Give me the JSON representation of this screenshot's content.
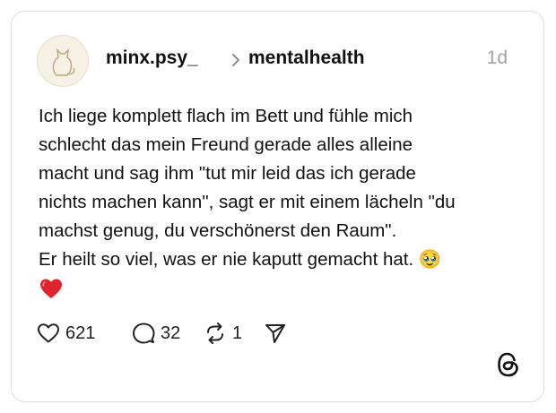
{
  "post": {
    "author": "minx.psy_",
    "community": "mentalhealth",
    "time": "1d",
    "text": "Ich liege komplett flach im Bett und fühle mich\nschlecht das mein Freund gerade alles alleine\nmacht und sag ihm \"tut mir leid das ich gerade\nnichts machen kann\", sagt er mit einem lächeln \"du\nmachst genug, du verschönerst den Raum\".\nEr heilt so viel, was er nie kaputt gemacht hat. 🥹",
    "trailing_emoji": "red-heart-emoji"
  },
  "actions": {
    "likes": "621",
    "comments": "32",
    "reposts": "1",
    "like_icon": "heart-outline-icon",
    "comment_icon": "speech-bubble-icon",
    "repost_icon": "repost-icon",
    "share_icon": "paper-plane-icon"
  },
  "branding": {
    "logo": "threads-logo-icon"
  },
  "colors": {
    "text": "#111111",
    "muted": "#a3a3a3",
    "border": "#dcdcdc",
    "heart": "#e0242d",
    "avatar_bg": "#f6f1e4"
  }
}
